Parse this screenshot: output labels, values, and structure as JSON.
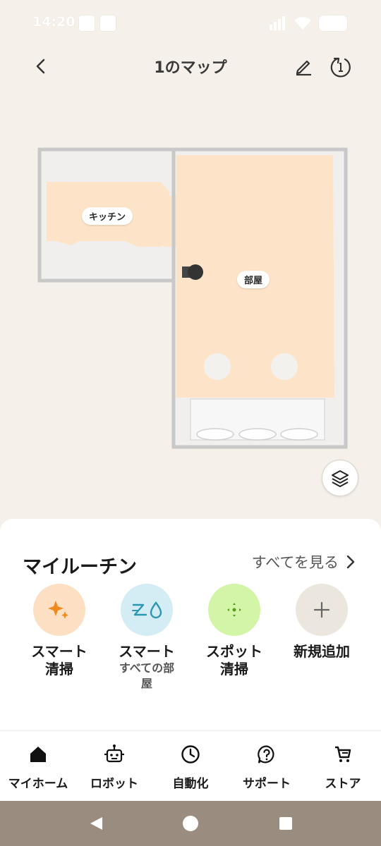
{
  "status_bar": {
    "time": "14:20"
  },
  "header": {
    "title": "1のマップ"
  },
  "map": {
    "rooms": [
      {
        "name": "キッチン"
      },
      {
        "name": "部屋"
      }
    ]
  },
  "routines": {
    "title": "マイルーチン",
    "see_all": "すべてを見る",
    "items": [
      {
        "title": "スマート\n清掃",
        "subtitle": "",
        "icon": "sparkle-icon",
        "color": "#fde0c4"
      },
      {
        "title": "スマート",
        "subtitle": "すべての部\n屋",
        "icon": "vacuum-mop-icon",
        "color": "#d4ecf4"
      },
      {
        "title": "スポット\n清掃",
        "subtitle": "",
        "icon": "spot-icon",
        "color": "#d3f5a8"
      },
      {
        "title": "新規追加",
        "subtitle": "",
        "icon": "plus-icon",
        "color": "#ebe7df"
      }
    ]
  },
  "nav": {
    "items": [
      {
        "label": "マイホーム",
        "icon": "home-icon"
      },
      {
        "label": "ロボット",
        "icon": "robot-icon"
      },
      {
        "label": "自動化",
        "icon": "clock-icon"
      },
      {
        "label": "サポート",
        "icon": "help-icon"
      },
      {
        "label": "ストア",
        "icon": "cart-icon"
      }
    ]
  },
  "colors": {
    "background": "#f5f1ea",
    "room_fill": "#fde4c8",
    "wall": "#c9c9c9",
    "nav_bar": "#9a8d80"
  }
}
